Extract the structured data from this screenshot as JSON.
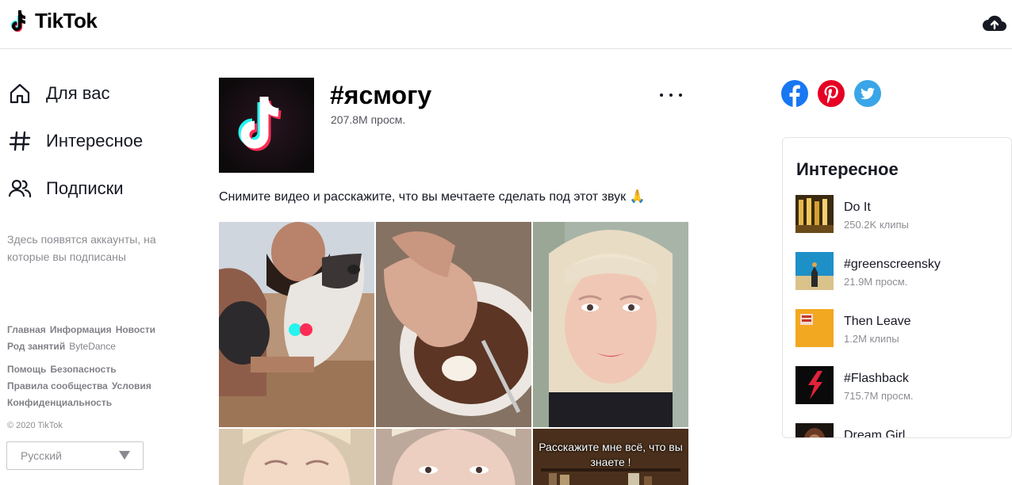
{
  "header": {
    "logo_text": "TikTok",
    "upload_icon": "cloud-upload-icon"
  },
  "sidebar": {
    "nav": [
      {
        "label": "Для вас",
        "icon": "home-icon"
      },
      {
        "label": "Интересное",
        "icon": "hashtag-icon"
      },
      {
        "label": "Подписки",
        "icon": "users-icon"
      }
    ],
    "follow_hint": "Здесь появятся аккаунты, на которые вы подписаны",
    "footer_rows": [
      [
        "Главная",
        "Информация",
        "Новости"
      ],
      [
        "Род занятий",
        "ByteDance"
      ],
      [
        "Помощь",
        "Безопасность"
      ],
      [
        "Правила сообщества",
        "Условия"
      ],
      [
        "Конфиденциальность"
      ]
    ],
    "copyright": "© 2020 TikTok",
    "language": "Русский"
  },
  "main": {
    "tag_title": "#ясмогу",
    "tag_views": "207.8M просм.",
    "description": "Снимите видео и расскажите, что вы мечтаете сделать под этот звук 🙏",
    "videos": [
      {
        "caption": ""
      },
      {
        "caption": ""
      },
      {
        "caption": ""
      },
      {
        "caption": ""
      },
      {
        "caption": ""
      },
      {
        "caption": "Расскажите мне всё, что вы знаете !"
      }
    ]
  },
  "right": {
    "share": [
      {
        "icon": "facebook-icon",
        "color": "#1877f2"
      },
      {
        "icon": "pinterest-icon",
        "color": "#e60023"
      },
      {
        "icon": "twitter-icon",
        "color": "#1da1f2"
      }
    ],
    "discover_title": "Интересное",
    "discover_items": [
      {
        "name": "Do It",
        "sub": "250.2K клипы"
      },
      {
        "name": "#greenscreensky",
        "sub": "21.9M просм."
      },
      {
        "name": "Then Leave",
        "sub": "1.2M клипы"
      },
      {
        "name": "#Flashback",
        "sub": "715.7M просм."
      },
      {
        "name": "Dream Girl",
        "sub": ""
      }
    ]
  },
  "colors": {
    "brand_cyan": "#25f4ee",
    "brand_red": "#fe2c55",
    "text": "#161823"
  }
}
